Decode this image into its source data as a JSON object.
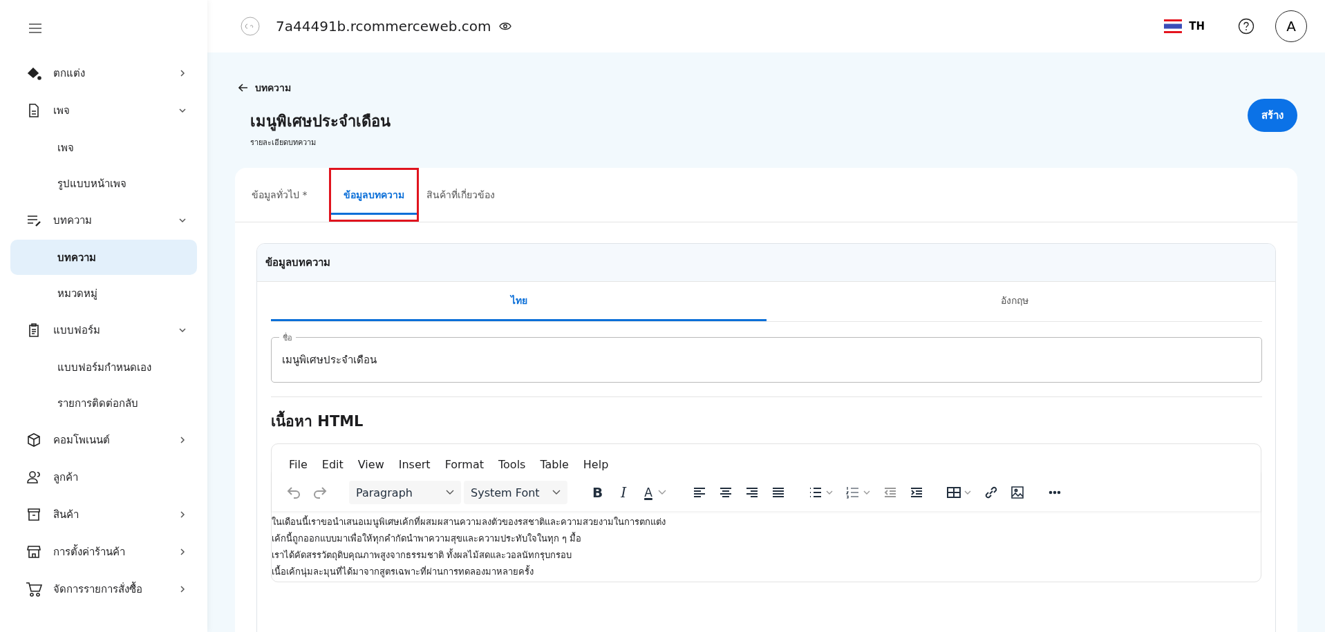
{
  "sidebar": {
    "items": [
      {
        "label": "ตกแต่ง",
        "expanded": false
      },
      {
        "label": "เพจ",
        "expanded": true,
        "children": [
          {
            "label": "เพจ",
            "selected": false
          },
          {
            "label": "รูปแบบหน้าเพจ",
            "selected": false
          }
        ]
      },
      {
        "label": "บทความ",
        "expanded": true,
        "children": [
          {
            "label": "บทความ",
            "selected": true
          },
          {
            "label": "หมวดหมู่",
            "selected": false
          }
        ]
      },
      {
        "label": "แบบฟอร์ม",
        "expanded": true,
        "children": [
          {
            "label": "แบบฟอร์มกำหนดเอง",
            "selected": false
          },
          {
            "label": "รายการติดต่อกลับ",
            "selected": false
          }
        ]
      },
      {
        "label": "คอมโพเนนต์",
        "expanded": false
      },
      {
        "label": "ลูกค้า"
      },
      {
        "label": "สินค้า",
        "expanded": false
      },
      {
        "label": "การตั้งค่าร้านค้า",
        "expanded": false
      },
      {
        "label": "จัดการรายการสั่งซื้อ",
        "expanded": false
      }
    ]
  },
  "header": {
    "domain": "7a44491b.rcommerceweb.com",
    "language": "TH",
    "avatar": "A"
  },
  "page": {
    "back_link": "บทความ",
    "title": "เมนูพิเศษประจำเดือน",
    "subtitle": "รายละเอียดบทความ",
    "create_button": "สร้าง"
  },
  "tabs": [
    {
      "label": "ข้อมูลทั่วไป *",
      "selected": false,
      "highlighted": false
    },
    {
      "label": "ข้อมูลบทความ",
      "selected": true,
      "highlighted": true
    },
    {
      "label": "สินค้าที่เกี่ยวข้อง",
      "selected": false,
      "highlighted": false
    }
  ],
  "section": {
    "title": "ข้อมูลบทความ",
    "language_tabs": [
      {
        "label": "ไทย",
        "selected": true
      },
      {
        "label": "อังกฤษ",
        "selected": false
      }
    ],
    "name_field": {
      "label": "ชื่อ",
      "value": "เมนูพิเศษประจำเดือน"
    },
    "html_heading": "เนื้อหา HTML",
    "editor": {
      "menu": [
        "File",
        "Edit",
        "View",
        "Insert",
        "Format",
        "Tools",
        "Table",
        "Help"
      ],
      "toolbar": [
        [
          {
            "kind": "undo",
            "disabled": true
          },
          {
            "kind": "redo",
            "disabled": true
          }
        ],
        [
          {
            "kind": "select",
            "label": "Paragraph"
          },
          {
            "kind": "select",
            "label": "System Font"
          }
        ],
        [
          {
            "kind": "bold",
            "label": "B"
          },
          {
            "kind": "italic",
            "label": "I"
          },
          {
            "kind": "color",
            "label": "A"
          }
        ],
        [
          {
            "kind": "align-left"
          },
          {
            "kind": "align-center"
          },
          {
            "kind": "align-right"
          },
          {
            "kind": "justify"
          }
        ],
        [
          {
            "kind": "bullets"
          },
          {
            "kind": "numbers"
          },
          {
            "kind": "outdent",
            "disabled": true
          },
          {
            "kind": "indent",
            "disabled": false
          }
        ],
        [
          {
            "kind": "table"
          },
          {
            "kind": "link"
          },
          {
            "kind": "image"
          }
        ],
        [
          {
            "kind": "more"
          }
        ]
      ],
      "lines": [
        "ในเดือนนี้เราขอนำเสนอเมนูพิเศษเค้กที่ผสมผสานความลงตัวของรสชาติและความสวยงามในการตกแต่ง",
        "เค้กนี้ถูกออกแบบมาเพื่อให้ทุกคำกัดนำพาความสุขและความประทับใจในทุก ๆ มื้อ",
        "เราได้คัดสรรวัตถุดิบคุณภาพสูงจากธรรมชาติ ทั้งผลไม้สดและวอลนัทกรุบกรอบ",
        "เนื้อเค้กนุ่มละมุนที่ได้มาจากสูตรเฉพาะที่ผ่านการทดลองมาหลายครั้ง"
      ]
    }
  }
}
